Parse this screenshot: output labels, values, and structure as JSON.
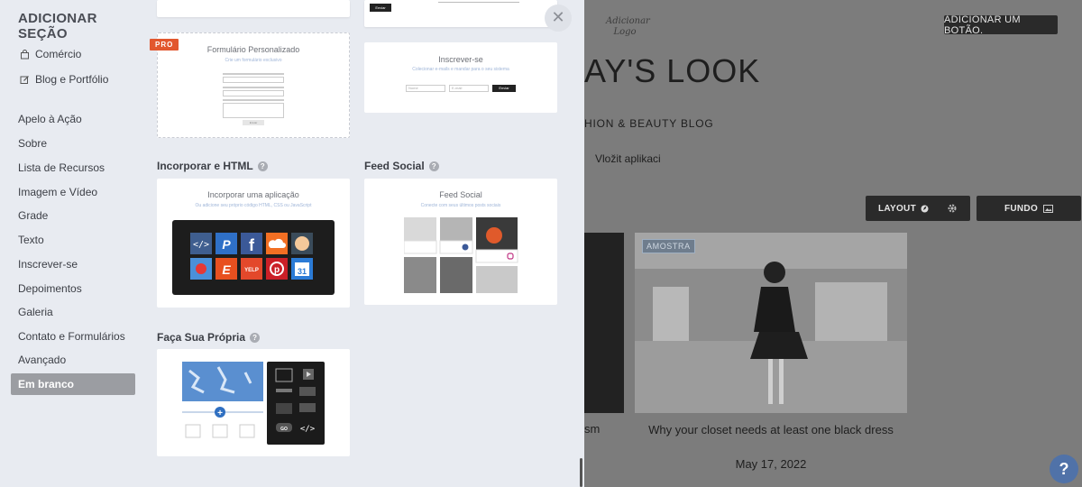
{
  "sidebar": {
    "title": "ADICIONAR SEÇÃO",
    "items": [
      {
        "label": "Comércio",
        "icon": "shopping-bag-icon"
      },
      {
        "label": "Blog e Portfólio",
        "icon": "edit-icon"
      },
      {
        "label": "Apelo à Ação"
      },
      {
        "label": "Sobre"
      },
      {
        "label": "Lista de Recursos"
      },
      {
        "label": "Imagem e Vídeo"
      },
      {
        "label": "Grade"
      },
      {
        "label": "Texto"
      },
      {
        "label": "Inscrever-se"
      },
      {
        "label": "Depoimentos"
      },
      {
        "label": "Galeria"
      },
      {
        "label": "Contato e Formulários"
      },
      {
        "label": "Avançado"
      },
      {
        "label": "Em branco",
        "active": true
      }
    ]
  },
  "panel": {
    "top_left_button": "Enviar",
    "form_card": {
      "badge": "PRO",
      "title": "Formulário Personalizado",
      "subtitle": "Crie um formulário exclusivo",
      "button": "Enviar"
    },
    "subscribe_card": {
      "title": "Inscrever-se",
      "subtitle": "Colecionar e-mails e mandar para o seu sistema",
      "field1": "Nome",
      "field2": "E-mail",
      "button": "Enviar"
    },
    "embed_section": {
      "heading": "Incorporar e HTML",
      "title": "Incorporar uma aplicação",
      "subtitle": "Ou adicione seu próprio código HTML, CSS ou JavaScript"
    },
    "social_section": {
      "heading": "Feed Social",
      "title": "Feed Social",
      "subtitle": "Conecte com seus últimos posts sociais"
    },
    "diy_section": {
      "heading": "Faça Sua Própria"
    },
    "help_glyph": "?",
    "close_glyph": "✕"
  },
  "preview": {
    "logo_text": "Adicionar Logo",
    "add_button": "ADICIONAR UM BOTÃO.",
    "hero_title": "AY'S LOOK",
    "subtitle": "HION & BEAUTY BLOG",
    "app_text": "Vložit aplikaci",
    "layout_button": "LAYOUT",
    "background_button": "FUNDO",
    "sample_badge": "AMOSTRA",
    "left_post_fragment": "sm",
    "post_title": "Why your closet needs at least one black dress",
    "post_date": "May 17, 2022",
    "help_fab": "?"
  },
  "colors": {
    "panel_bg": "#e8ebf1",
    "pro_badge": "#e2572e",
    "active_item": "#9b9da2",
    "help_fab": "#5072a8",
    "dark_button": "#2a2a2a"
  }
}
